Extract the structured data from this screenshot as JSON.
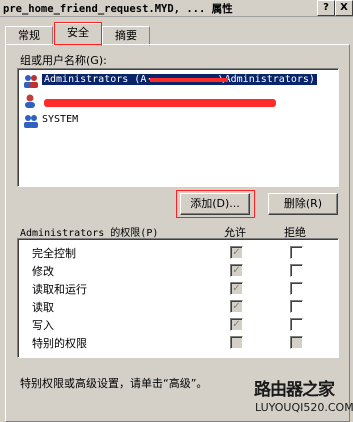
{
  "window": {
    "title": "pre_home_friend_request.MYD, ... 属性",
    "help_btn": "?",
    "close_btn": "X"
  },
  "tabs": [
    {
      "label": "常规"
    },
    {
      "label": "安全"
    },
    {
      "label": "摘要"
    }
  ],
  "users_section": {
    "label": "组或用户名称(G):",
    "users": [
      {
        "name": "Administrators (A············\\Administrators)",
        "selected": true
      },
      {
        "name": "",
        "selected": false
      },
      {
        "name": "SYSTEM",
        "selected": false
      }
    ]
  },
  "buttons": {
    "add": "添加(D)...",
    "remove": "删除(R)"
  },
  "permissions": {
    "label": "Administrators 的权限(P)",
    "allow_header": "允许",
    "deny_header": "拒绝",
    "rows": [
      {
        "name": "完全控制",
        "allow": true,
        "deny": false
      },
      {
        "name": "修改",
        "allow": true,
        "deny": false
      },
      {
        "name": "读取和运行",
        "allow": true,
        "deny": false
      },
      {
        "name": "读取",
        "allow": true,
        "deny": false
      },
      {
        "name": "写入",
        "allow": true,
        "deny": false
      },
      {
        "name": "特别的权限",
        "allow": false,
        "deny": false
      }
    ]
  },
  "footer_text": "特别权限或高级设置，请单击“高级”。",
  "watermark": {
    "title": "路由器之家",
    "sub": "LUYOUQI520.COM"
  }
}
